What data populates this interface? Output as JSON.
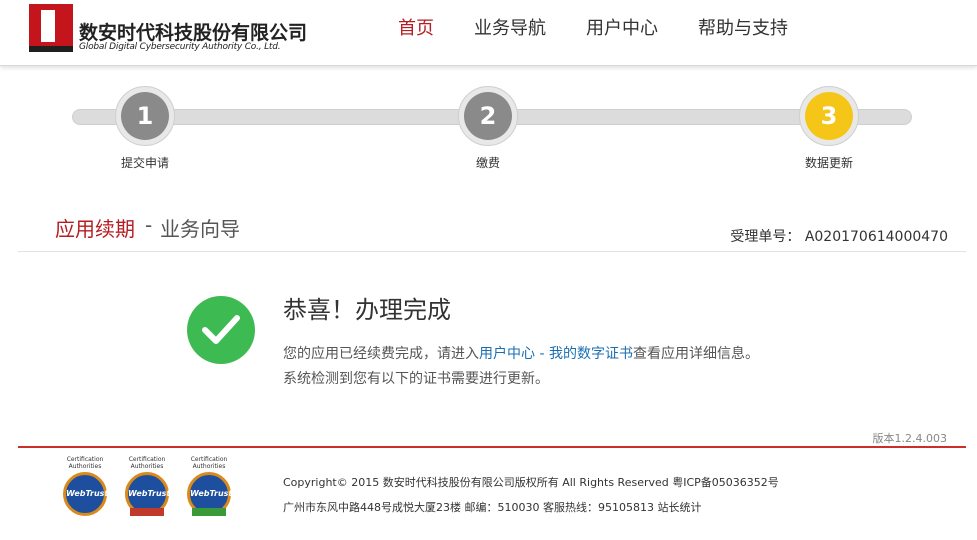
{
  "header": {
    "logo_cn": "数安时代科技股份有限公司",
    "logo_en": "Global Digital Cybersecurity Authority Co., Ltd.",
    "nav": [
      {
        "label": "首页",
        "active": true
      },
      {
        "label": "业务导航",
        "active": false
      },
      {
        "label": "用户中心",
        "active": false
      },
      {
        "label": "帮助与支持",
        "active": false
      }
    ]
  },
  "steps": [
    {
      "number": "1",
      "label": "提交申请",
      "state": "done"
    },
    {
      "number": "2",
      "label": "缴费",
      "state": "done"
    },
    {
      "number": "3",
      "label": "数据更新",
      "state": "current"
    }
  ],
  "title": {
    "main": "应用续期",
    "separator": "-",
    "sub": "业务向导",
    "ticket_label": "受理单号：",
    "ticket_value": "A020170614000470"
  },
  "result": {
    "heading": "恭喜！办理完成",
    "msg1_prefix": "您的应用已经续费完成，请进入",
    "msg1_link1": "用户中心",
    "msg1_sep": " - ",
    "msg1_link2": "我的数字证书",
    "msg1_suffix": "查看应用详细信息。",
    "msg2": "系统检测到您有以下的证书需要进行更新。"
  },
  "version": "版本1.2.4.003",
  "footer": {
    "badges": [
      {
        "caption": "Certification Authorities",
        "seal": "WebTrust"
      },
      {
        "caption": "Certification Authorities",
        "seal": "WebTrust"
      },
      {
        "caption": "Certification Authorities",
        "seal": "WebTrust"
      }
    ],
    "copyright": "Copyright© 2015 数安时代科技股份有限公司版权所有 All Rights Reserved 粤ICP备05036352号",
    "address": "广州市东风中路448号成悦大厦23楼    邮编：510030 客服热线：95105813 站长统计"
  },
  "colors": {
    "brand_red": "#b51d22",
    "link_blue": "#1a6fb3",
    "success_green": "#3dbb52",
    "step_current": "#f5c518",
    "step_done": "#8a8a8a"
  }
}
